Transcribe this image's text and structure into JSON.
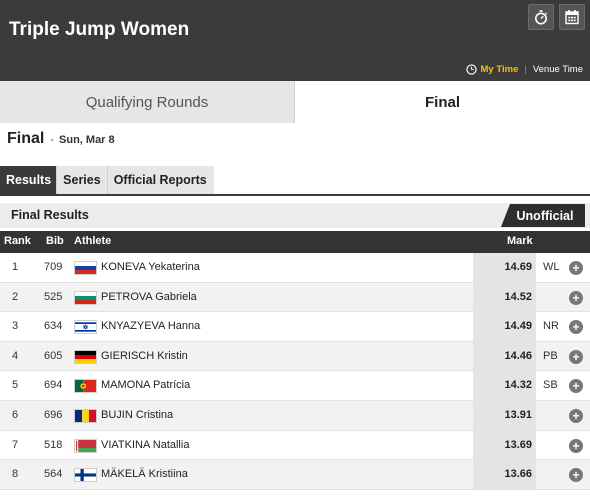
{
  "header": {
    "title": "Triple Jump Women",
    "my_time": "My Time",
    "separator": "|",
    "venue_time": "Venue Time"
  },
  "round_tabs": [
    {
      "label": "Qualifying Rounds",
      "active": false
    },
    {
      "label": "Final",
      "active": true
    }
  ],
  "final_heading": {
    "title": "Final",
    "dash": "-",
    "date": "Sun, Mar 8"
  },
  "sub_tabs": [
    {
      "label": "Results",
      "active": true
    },
    {
      "label": "Series",
      "active": false
    },
    {
      "label": "Official Reports",
      "active": false
    }
  ],
  "results": {
    "title": "Final Results",
    "status_badge": "Unofficial"
  },
  "table": {
    "columns": [
      "Rank",
      "Bib",
      "Athlete",
      "Mark"
    ],
    "rows": [
      {
        "rank": "1",
        "bib": "709",
        "flag": "russia-flag",
        "athlete": "KONEVA Yekaterina",
        "mark": "14.69",
        "note": "WL"
      },
      {
        "rank": "2",
        "bib": "525",
        "flag": "bulgaria-flag",
        "athlete": "PETROVA Gabriela",
        "mark": "14.52",
        "note": ""
      },
      {
        "rank": "3",
        "bib": "634",
        "flag": "israel-flag",
        "athlete": "KNYAZYEVA Hanna",
        "mark": "14.49",
        "note": "NR"
      },
      {
        "rank": "4",
        "bib": "605",
        "flag": "germany-flag",
        "athlete": "GIERISCH Kristin",
        "mark": "14.46",
        "note": "PB"
      },
      {
        "rank": "5",
        "bib": "694",
        "flag": "portugal-flag",
        "athlete": "MAMONA Patrícia",
        "mark": "14.32",
        "note": "SB"
      },
      {
        "rank": "6",
        "bib": "696",
        "flag": "romania-flag",
        "athlete": "BUJIN Cristina",
        "mark": "13.91",
        "note": ""
      },
      {
        "rank": "7",
        "bib": "518",
        "flag": "belarus-flag",
        "athlete": "VIATKINA Natallia",
        "mark": "13.69",
        "note": ""
      },
      {
        "rank": "8",
        "bib": "564",
        "flag": "finland-flag",
        "athlete": "MÄKELÄ Kristiina",
        "mark": "13.66",
        "note": ""
      }
    ]
  },
  "colors": {
    "header_bg": "#3b3b3b",
    "my_time_accent": "#f2c200",
    "table_head_bg": "#333333",
    "badge_bg": "#2e2e2e"
  }
}
